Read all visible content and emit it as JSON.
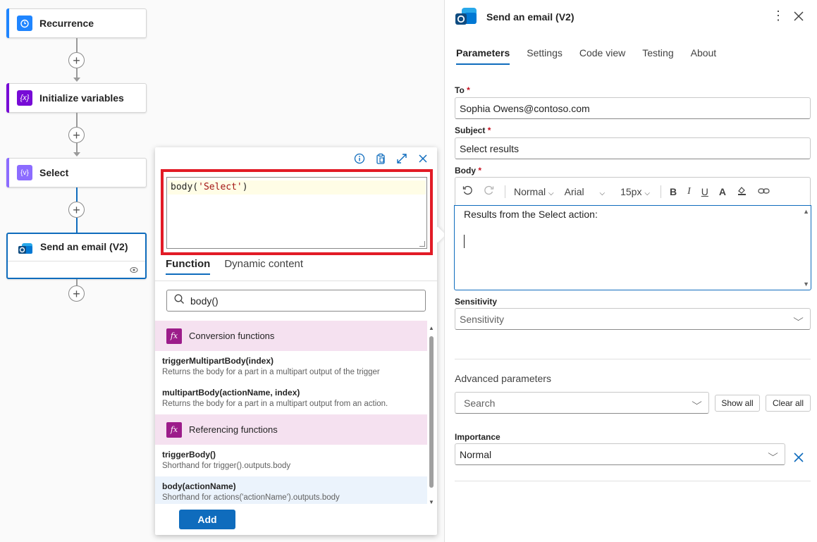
{
  "canvas": {
    "nodes": [
      {
        "label": "Recurrence",
        "icon": "clock-icon",
        "color": "#1f85ff"
      },
      {
        "label": "Initialize variables",
        "icon": "variable-icon",
        "color": "#770bd6"
      },
      {
        "label": "Select",
        "icon": "data-operation-icon",
        "color": "#8c6cff"
      },
      {
        "label": "Send an email (V2)",
        "icon": "outlook-icon",
        "color": "#0f6cbd"
      }
    ]
  },
  "expression_popup": {
    "expression_fn": "body(",
    "expression_arg": "'Select'",
    "expression_close": ")",
    "tabs": [
      "Function",
      "Dynamic content"
    ],
    "search_value": "body()",
    "categories": [
      {
        "name": "Conversion functions",
        "icon": "fx",
        "items": [
          {
            "name": "triggerMultipartBody(index)",
            "desc": "Returns the body for a part in a multipart output of the trigger"
          },
          {
            "name": "multipartBody(actionName, index)",
            "desc": "Returns the body for a part in a multipart output from an action."
          }
        ]
      },
      {
        "name": "Referencing functions",
        "icon": "fx",
        "items": [
          {
            "name": "triggerBody()",
            "desc": "Shorthand for trigger().outputs.body"
          },
          {
            "name": "body(actionName)",
            "desc": "Shorthand for actions('actionName').outputs.body"
          }
        ]
      }
    ],
    "add_label": "Add"
  },
  "panel": {
    "title": "Send an email (V2)",
    "tabs": [
      "Parameters",
      "Settings",
      "Code view",
      "Testing",
      "About"
    ],
    "to_label": "To",
    "to_value": "Sophia Owens@contoso.com",
    "subject_label": "Subject",
    "subject_value": "Select results",
    "body_label": "Body",
    "required_mark": "*",
    "editor": {
      "style": "Normal",
      "font": "Arial",
      "size": "15px",
      "content": "Results from the Select action:"
    },
    "sensitivity_label": "Sensitivity",
    "sensitivity_placeholder": "Sensitivity",
    "advanced_label": "Advanced parameters",
    "advanced_placeholder": "Search",
    "show_all": "Show all",
    "clear_all": "Clear all",
    "importance_label": "Importance",
    "importance_value": "Normal"
  },
  "colors": {
    "accent": "#0f6cbd",
    "highlight_red": "#e21b26",
    "function_purple": "#9c1c8a"
  }
}
